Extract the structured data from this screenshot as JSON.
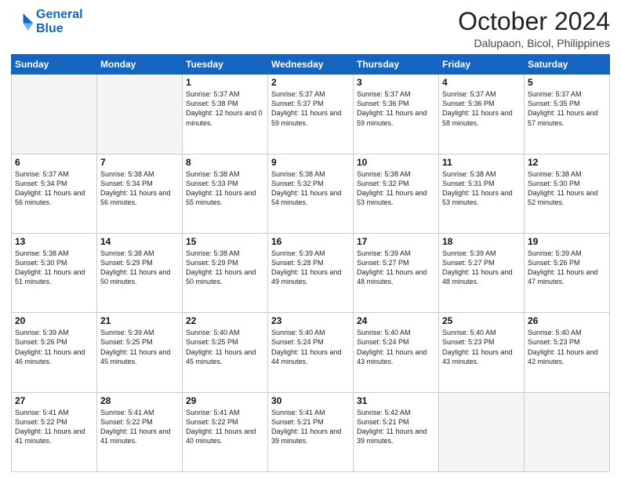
{
  "logo": {
    "line1": "General",
    "line2": "Blue"
  },
  "title": "October 2024",
  "location": "Dalupaon, Bicol, Philippines",
  "header_days": [
    "Sunday",
    "Monday",
    "Tuesday",
    "Wednesday",
    "Thursday",
    "Friday",
    "Saturday"
  ],
  "weeks": [
    [
      {
        "day": "",
        "sunrise": "",
        "sunset": "",
        "daylight": ""
      },
      {
        "day": "",
        "sunrise": "",
        "sunset": "",
        "daylight": ""
      },
      {
        "day": "1",
        "sunrise": "Sunrise: 5:37 AM",
        "sunset": "Sunset: 5:38 PM",
        "daylight": "Daylight: 12 hours and 0 minutes."
      },
      {
        "day": "2",
        "sunrise": "Sunrise: 5:37 AM",
        "sunset": "Sunset: 5:37 PM",
        "daylight": "Daylight: 11 hours and 59 minutes."
      },
      {
        "day": "3",
        "sunrise": "Sunrise: 5:37 AM",
        "sunset": "Sunset: 5:36 PM",
        "daylight": "Daylight: 11 hours and 59 minutes."
      },
      {
        "day": "4",
        "sunrise": "Sunrise: 5:37 AM",
        "sunset": "Sunset: 5:36 PM",
        "daylight": "Daylight: 11 hours and 58 minutes."
      },
      {
        "day": "5",
        "sunrise": "Sunrise: 5:37 AM",
        "sunset": "Sunset: 5:35 PM",
        "daylight": "Daylight: 11 hours and 57 minutes."
      }
    ],
    [
      {
        "day": "6",
        "sunrise": "Sunrise: 5:37 AM",
        "sunset": "Sunset: 5:34 PM",
        "daylight": "Daylight: 11 hours and 56 minutes."
      },
      {
        "day": "7",
        "sunrise": "Sunrise: 5:38 AM",
        "sunset": "Sunset: 5:34 PM",
        "daylight": "Daylight: 11 hours and 56 minutes."
      },
      {
        "day": "8",
        "sunrise": "Sunrise: 5:38 AM",
        "sunset": "Sunset: 5:33 PM",
        "daylight": "Daylight: 11 hours and 55 minutes."
      },
      {
        "day": "9",
        "sunrise": "Sunrise: 5:38 AM",
        "sunset": "Sunset: 5:32 PM",
        "daylight": "Daylight: 11 hours and 54 minutes."
      },
      {
        "day": "10",
        "sunrise": "Sunrise: 5:38 AM",
        "sunset": "Sunset: 5:32 PM",
        "daylight": "Daylight: 11 hours and 53 minutes."
      },
      {
        "day": "11",
        "sunrise": "Sunrise: 5:38 AM",
        "sunset": "Sunset: 5:31 PM",
        "daylight": "Daylight: 11 hours and 53 minutes."
      },
      {
        "day": "12",
        "sunrise": "Sunrise: 5:38 AM",
        "sunset": "Sunset: 5:30 PM",
        "daylight": "Daylight: 11 hours and 52 minutes."
      }
    ],
    [
      {
        "day": "13",
        "sunrise": "Sunrise: 5:38 AM",
        "sunset": "Sunset: 5:30 PM",
        "daylight": "Daylight: 11 hours and 51 minutes."
      },
      {
        "day": "14",
        "sunrise": "Sunrise: 5:38 AM",
        "sunset": "Sunset: 5:29 PM",
        "daylight": "Daylight: 11 hours and 50 minutes."
      },
      {
        "day": "15",
        "sunrise": "Sunrise: 5:38 AM",
        "sunset": "Sunset: 5:29 PM",
        "daylight": "Daylight: 11 hours and 50 minutes."
      },
      {
        "day": "16",
        "sunrise": "Sunrise: 5:39 AM",
        "sunset": "Sunset: 5:28 PM",
        "daylight": "Daylight: 11 hours and 49 minutes."
      },
      {
        "day": "17",
        "sunrise": "Sunrise: 5:39 AM",
        "sunset": "Sunset: 5:27 PM",
        "daylight": "Daylight: 11 hours and 48 minutes."
      },
      {
        "day": "18",
        "sunrise": "Sunrise: 5:39 AM",
        "sunset": "Sunset: 5:27 PM",
        "daylight": "Daylight: 11 hours and 48 minutes."
      },
      {
        "day": "19",
        "sunrise": "Sunrise: 5:39 AM",
        "sunset": "Sunset: 5:26 PM",
        "daylight": "Daylight: 11 hours and 47 minutes."
      }
    ],
    [
      {
        "day": "20",
        "sunrise": "Sunrise: 5:39 AM",
        "sunset": "Sunset: 5:26 PM",
        "daylight": "Daylight: 11 hours and 46 minutes."
      },
      {
        "day": "21",
        "sunrise": "Sunrise: 5:39 AM",
        "sunset": "Sunset: 5:25 PM",
        "daylight": "Daylight: 11 hours and 45 minutes."
      },
      {
        "day": "22",
        "sunrise": "Sunrise: 5:40 AM",
        "sunset": "Sunset: 5:25 PM",
        "daylight": "Daylight: 11 hours and 45 minutes."
      },
      {
        "day": "23",
        "sunrise": "Sunrise: 5:40 AM",
        "sunset": "Sunset: 5:24 PM",
        "daylight": "Daylight: 11 hours and 44 minutes."
      },
      {
        "day": "24",
        "sunrise": "Sunrise: 5:40 AM",
        "sunset": "Sunset: 5:24 PM",
        "daylight": "Daylight: 11 hours and 43 minutes."
      },
      {
        "day": "25",
        "sunrise": "Sunrise: 5:40 AM",
        "sunset": "Sunset: 5:23 PM",
        "daylight": "Daylight: 11 hours and 43 minutes."
      },
      {
        "day": "26",
        "sunrise": "Sunrise: 5:40 AM",
        "sunset": "Sunset: 5:23 PM",
        "daylight": "Daylight: 11 hours and 42 minutes."
      }
    ],
    [
      {
        "day": "27",
        "sunrise": "Sunrise: 5:41 AM",
        "sunset": "Sunset: 5:22 PM",
        "daylight": "Daylight: 11 hours and 41 minutes."
      },
      {
        "day": "28",
        "sunrise": "Sunrise: 5:41 AM",
        "sunset": "Sunset: 5:22 PM",
        "daylight": "Daylight: 11 hours and 41 minutes."
      },
      {
        "day": "29",
        "sunrise": "Sunrise: 5:41 AM",
        "sunset": "Sunset: 5:22 PM",
        "daylight": "Daylight: 11 hours and 40 minutes."
      },
      {
        "day": "30",
        "sunrise": "Sunrise: 5:41 AM",
        "sunset": "Sunset: 5:21 PM",
        "daylight": "Daylight: 11 hours and 39 minutes."
      },
      {
        "day": "31",
        "sunrise": "Sunrise: 5:42 AM",
        "sunset": "Sunset: 5:21 PM",
        "daylight": "Daylight: 11 hours and 39 minutes."
      },
      {
        "day": "",
        "sunrise": "",
        "sunset": "",
        "daylight": ""
      },
      {
        "day": "",
        "sunrise": "",
        "sunset": "",
        "daylight": ""
      }
    ]
  ]
}
